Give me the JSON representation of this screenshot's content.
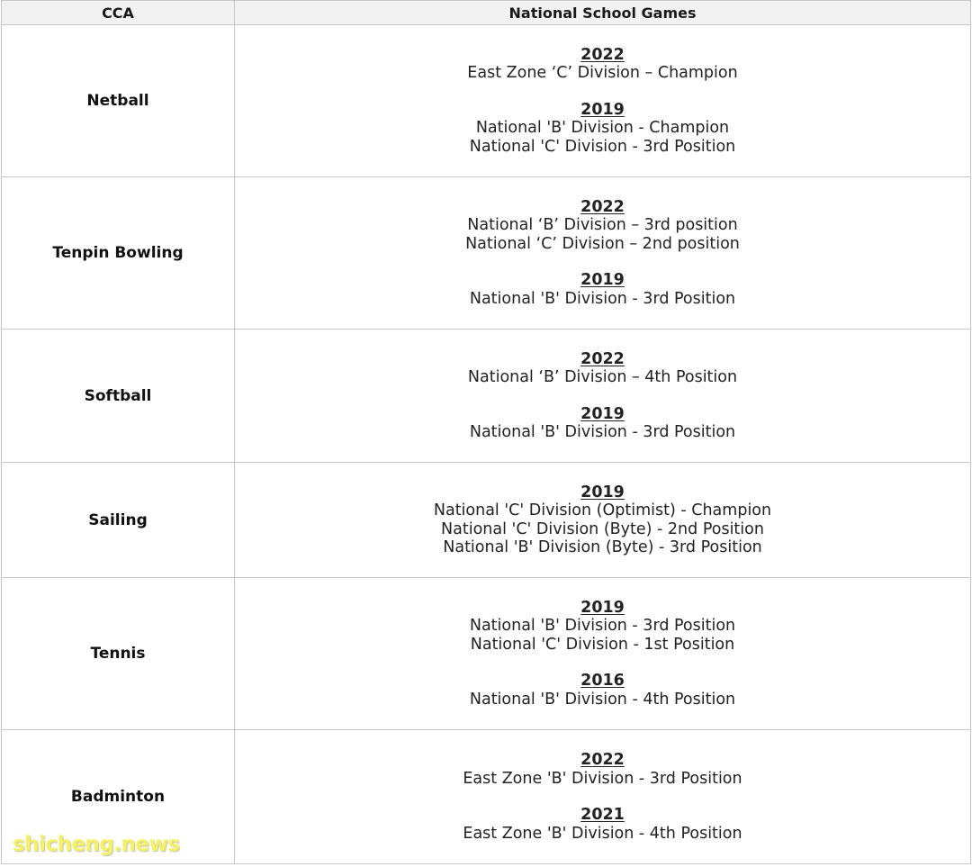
{
  "table": {
    "header": {
      "col1": "CCA",
      "col2": "National School Games"
    },
    "rows": [
      {
        "cca": "Netball",
        "groups": [
          {
            "year": "2022",
            "lines": [
              "East Zone ‘C’ Division – Champion"
            ]
          },
          {
            "year": "2019",
            "lines": [
              "National 'B' Division - Champion",
              "National 'C' Division - 3rd Position"
            ]
          }
        ]
      },
      {
        "cca": "Tenpin Bowling",
        "groups": [
          {
            "year": "2022",
            "lines": [
              "National ‘B’ Division – 3rd position",
              "National ‘C’ Division – 2nd position"
            ]
          },
          {
            "year": "2019",
            "lines": [
              "National 'B' Division - 3rd Position"
            ]
          }
        ]
      },
      {
        "cca": "Softball",
        "groups": [
          {
            "year": "2022",
            "lines": [
              "National ‘B’ Division – 4th Position"
            ]
          },
          {
            "year": "2019",
            "lines": [
              "National 'B' Division - 3rd Position"
            ]
          }
        ]
      },
      {
        "cca": "Sailing",
        "groups": [
          {
            "year": "2019",
            "lines": [
              "National 'C' Division (Optimist) - Champion",
              "National 'C' Division (Byte) - 2nd Position",
              "National 'B' Division (Byte) - 3rd Position"
            ]
          }
        ]
      },
      {
        "cca": "Tennis",
        "groups": [
          {
            "year": "2019",
            "lines": [
              "National 'B' Division - 3rd Position",
              "National 'C' Division - 1st Position"
            ]
          },
          {
            "year": "2016",
            "lines": [
              "National 'B' Division - 4th Position"
            ]
          }
        ]
      },
      {
        "cca": "Badminton",
        "groups": [
          {
            "year": "2022",
            "lines": [
              "East Zone 'B' Division - 3rd Position"
            ]
          },
          {
            "year": "2021",
            "lines": [
              "East Zone 'B' Division - 4th Position"
            ]
          }
        ]
      }
    ]
  },
  "watermark": {
    "text": "shicheng.news",
    "color": "#f4f06a"
  }
}
